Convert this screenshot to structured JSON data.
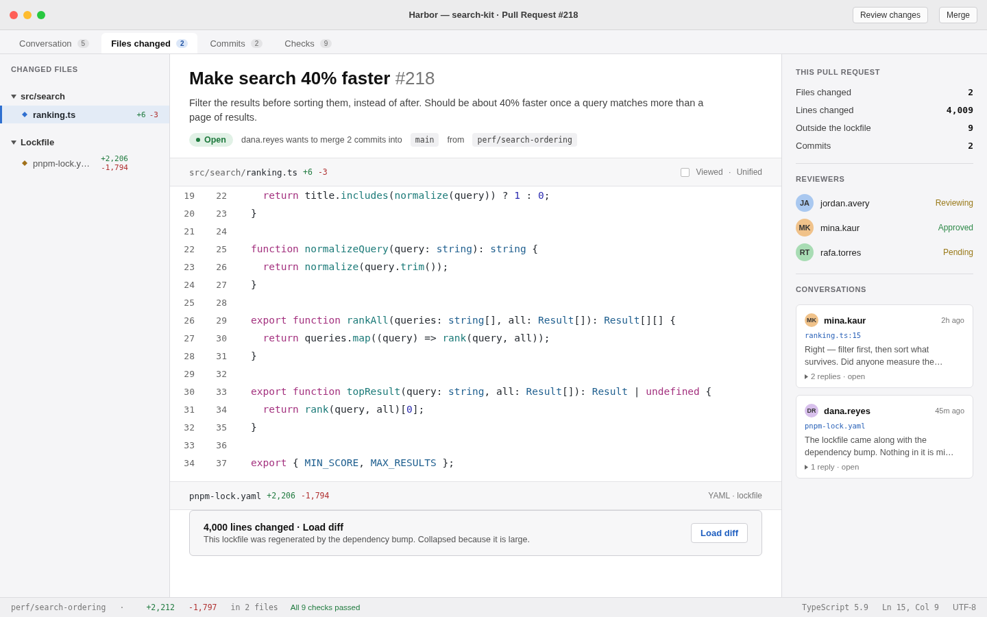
{
  "window": {
    "title": "Harbor — search-kit · Pull Request #218",
    "buttons": [
      "Review changes",
      "Merge"
    ]
  },
  "tabs": [
    {
      "label": "Conversation",
      "count": "5",
      "selected": false
    },
    {
      "label": "Files changed",
      "count": "2",
      "selected": true
    },
    {
      "label": "Commits",
      "count": "2",
      "selected": false
    },
    {
      "label": "Checks",
      "count": "9",
      "selected": false
    }
  ],
  "sidebar": {
    "heading": "CHANGED FILES",
    "groups": [
      {
        "name": "src/search",
        "expanded": true,
        "files": [
          {
            "name": "ranking.ts",
            "added": "+6",
            "removed": "-3",
            "selected": true,
            "color": "#2f6fd0"
          }
        ]
      },
      {
        "name": "Lockfile",
        "expanded": true,
        "files": [
          {
            "name": "pnpm-lock.y…",
            "added": "+2,206",
            "removed": "-1,794",
            "selected": false,
            "color": "#a0701a"
          }
        ]
      }
    ]
  },
  "pr": {
    "title": "Make search 40% faster",
    "number": "#218",
    "description": "Filter the results before sorting them, instead of after. Should be about 40% faster once a query matches more than a page of results.",
    "status": "Open",
    "merge_text": "dana.reyes wants to merge 2 commits into",
    "base": "main",
    "from": "from",
    "head": "perf/search-ordering"
  },
  "diff": {
    "dir": "src/search/",
    "file": "ranking.ts",
    "added": "+6",
    "removed": "-3",
    "viewed": false,
    "viewed_label": "Viewed",
    "separator": "·",
    "mode": "Unified",
    "lines": [
      {
        "old": "19",
        "new": "22",
        "tokens": [
          {
            "kind": "kw",
            "text": "  return"
          },
          {
            "kind": "plain",
            "text": " title."
          },
          {
            "kind": "fn",
            "text": "includes"
          },
          {
            "kind": "plain",
            "text": "("
          },
          {
            "kind": "fn",
            "text": "normalize"
          },
          {
            "kind": "plain",
            "text": "(query)) ? "
          },
          {
            "kind": "num",
            "text": "1"
          },
          {
            "kind": "plain",
            "text": " : "
          },
          {
            "kind": "num",
            "text": "0"
          },
          {
            "kind": "plain",
            "text": ";"
          }
        ]
      },
      {
        "old": "20",
        "new": "23",
        "tokens": [
          {
            "kind": "plain",
            "text": "}"
          }
        ]
      },
      {
        "old": "21",
        "new": "24"
      },
      {
        "old": "22",
        "new": "25",
        "tokens": [
          {
            "kind": "kw",
            "text": "function "
          },
          {
            "kind": "fn",
            "text": "normalizeQuery"
          },
          {
            "kind": "plain",
            "text": "(query: "
          },
          {
            "kind": "type",
            "text": "string"
          },
          {
            "kind": "plain",
            "text": "): "
          },
          {
            "kind": "type",
            "text": "string"
          },
          {
            "kind": "plain",
            "text": " {"
          }
        ]
      },
      {
        "old": "23",
        "new": "26",
        "tokens": [
          {
            "kind": "kw",
            "text": "  return "
          },
          {
            "kind": "fn",
            "text": "normalize"
          },
          {
            "kind": "plain",
            "text": "(query."
          },
          {
            "kind": "fn",
            "text": "trim"
          },
          {
            "kind": "plain",
            "text": "());"
          }
        ]
      },
      {
        "old": "24",
        "new": "27",
        "tokens": [
          {
            "kind": "plain",
            "text": "}"
          }
        ]
      },
      {
        "old": "25",
        "new": "28"
      },
      {
        "old": "26",
        "new": "29",
        "tokens": [
          {
            "kind": "kw",
            "text": "export function "
          },
          {
            "kind": "fn",
            "text": "rankAll"
          },
          {
            "kind": "plain",
            "text": "(queries: "
          },
          {
            "kind": "type",
            "text": "string"
          },
          {
            "kind": "plain",
            "text": "[], all: "
          },
          {
            "kind": "type",
            "text": "Result"
          },
          {
            "kind": "plain",
            "text": "[]): "
          },
          {
            "kind": "type",
            "text": "Result"
          },
          {
            "kind": "plain",
            "text": "[][] {"
          }
        ]
      },
      {
        "old": "27",
        "new": "30",
        "tokens": [
          {
            "kind": "kw",
            "text": "  return"
          },
          {
            "kind": "plain",
            "text": " queries."
          },
          {
            "kind": "fn",
            "text": "map"
          },
          {
            "kind": "plain",
            "text": "((query) => "
          },
          {
            "kind": "fn",
            "text": "rank"
          },
          {
            "kind": "plain",
            "text": "(query, all));"
          }
        ]
      },
      {
        "old": "28",
        "new": "31",
        "tokens": [
          {
            "kind": "plain",
            "text": "}"
          }
        ]
      },
      {
        "old": "29",
        "new": "32"
      },
      {
        "old": "30",
        "new": "33",
        "tokens": [
          {
            "kind": "kw",
            "text": "export function "
          },
          {
            "kind": "fn",
            "text": "topResult"
          },
          {
            "kind": "plain",
            "text": "(query: "
          },
          {
            "kind": "type",
            "text": "string"
          },
          {
            "kind": "plain",
            "text": ", all: "
          },
          {
            "kind": "type",
            "text": "Result"
          },
          {
            "kind": "plain",
            "text": "[]): "
          },
          {
            "kind": "type",
            "text": "Result"
          },
          {
            "kind": "plain",
            "text": " | "
          },
          {
            "kind": "kw",
            "text": "undefined"
          },
          {
            "kind": "plain",
            "text": " {"
          }
        ]
      },
      {
        "old": "31",
        "new": "34",
        "tokens": [
          {
            "kind": "kw",
            "text": "  return "
          },
          {
            "kind": "fn",
            "text": "rank"
          },
          {
            "kind": "plain",
            "text": "(query, all)["
          },
          {
            "kind": "num",
            "text": "0"
          },
          {
            "kind": "plain",
            "text": "];"
          }
        ]
      },
      {
        "old": "32",
        "new": "35",
        "tokens": [
          {
            "kind": "plain",
            "text": "}"
          }
        ]
      },
      {
        "old": "33",
        "new": "36"
      },
      {
        "old": "34",
        "new": "37",
        "tokens": [
          {
            "kind": "kw",
            "text": "export"
          },
          {
            "kind": "plain",
            "text": " { "
          },
          {
            "kind": "type",
            "text": "MIN_SCORE"
          },
          {
            "kind": "plain",
            "text": ", "
          },
          {
            "kind": "type",
            "text": "MAX_RESULTS"
          },
          {
            "kind": "plain",
            "text": " };"
          }
        ]
      }
    ]
  },
  "lockfile": {
    "file": "pnpm-lock.yaml",
    "added": "+2,206",
    "removed": "-1,794",
    "meta": "YAML · lockfile",
    "notice_title": "4,000 lines changed · Load diff",
    "notice_text": "This lockfile was regenerated by the dependency bump. Collapsed because it is large.",
    "button": "Load diff"
  },
  "summary": {
    "heading": "THIS PULL REQUEST",
    "rows": [
      {
        "label": "Files changed",
        "value": "2"
      },
      {
        "label": "Lines changed",
        "value": "4,009"
      },
      {
        "label": "Outside the lockfile",
        "value": "9"
      },
      {
        "label": "Commits",
        "value": "2"
      }
    ]
  },
  "reviewers": {
    "heading": "REVIEWERS",
    "items": [
      {
        "avatar": {
          "initials": "JA",
          "color": "#a9c8f0"
        },
        "name": "jordan.avery",
        "status": {
          "text": "Reviewing",
          "color": "#9a7a1a"
        }
      },
      {
        "avatar": {
          "initials": "MK",
          "color": "#f0c28a"
        },
        "name": "mina.kaur",
        "status": {
          "text": "Approved",
          "color": "#2f8a4a"
        }
      },
      {
        "avatar": {
          "initials": "RT",
          "color": "#a8dcb4"
        },
        "name": "rafa.torres",
        "status": {
          "text": "Pending",
          "color": "#9a7a1a"
        }
      }
    ]
  },
  "conversations": {
    "heading": "CONVERSATIONS",
    "items": [
      {
        "avatar": {
          "initials": "MK",
          "color": "#f0c28a"
        },
        "author": "mina.kaur",
        "time": "2h ago",
        "location": "ranking.ts:15",
        "text": "Right — filter first, then sort what survives. Did anyone measure the…",
        "replies": "2 replies · open"
      },
      {
        "avatar": {
          "initials": "DR",
          "color": "#d8c0ec"
        },
        "author": "dana.reyes",
        "time": "45m ago",
        "location": "pnpm-lock.yaml",
        "text": "The lockfile came along with the dependency bump. Nothing in it is mi…",
        "replies": "1 reply · open"
      }
    ]
  },
  "status_bar": {
    "branch": "perf/search-ordering",
    "sep": "·",
    "added": "+2,212",
    "removed": "-1,797",
    "files": "in 2 files",
    "checks": "All 9 checks passed",
    "language": "TypeScript 5.9",
    "position": "Ln 15, Col 9",
    "encoding": "UTF-8"
  }
}
